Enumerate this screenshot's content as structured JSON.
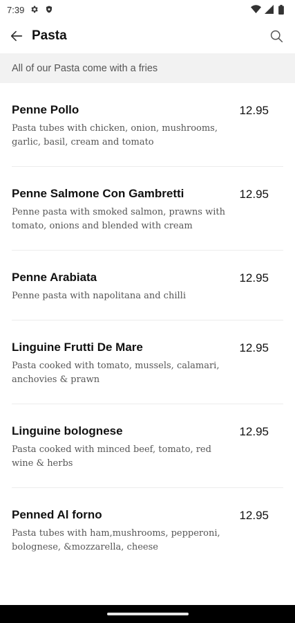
{
  "status_bar": {
    "time": "7:39",
    "left_icons": [
      "gear-icon",
      "shield-icon"
    ],
    "right_icons": [
      "wifi-icon",
      "signal-icon",
      "battery-icon"
    ]
  },
  "app_bar": {
    "title": "Pasta",
    "back_icon": "arrow-left-icon",
    "search_icon": "search-icon"
  },
  "banner": {
    "text": "All of our Pasta come with a fries"
  },
  "menu": {
    "items": [
      {
        "name": "Penne Pollo",
        "price": "12.95",
        "description": "Pasta tubes with chicken, onion, mushrooms, garlic, basil, cream and tomato"
      },
      {
        "name": "Penne Salmone Con Gambretti",
        "price": "12.95",
        "description": "Penne pasta with smoked salmon, prawns with tomato, onions and blended with cream"
      },
      {
        "name": "Penne Arabiata",
        "price": "12.95",
        "description": "Penne pasta with napolitana and chilli"
      },
      {
        "name": "Linguine Frutti De Mare",
        "price": "12.95",
        "description": "Pasta cooked with tomato, mussels, calamari, anchovies & prawn"
      },
      {
        "name": "Linguine bolognese",
        "price": "12.95",
        "description": "Pasta cooked with minced beef, tomato, red wine & herbs"
      },
      {
        "name": "Penned Al forno",
        "price": "12.95",
        "description": "Pasta tubes with ham,mushrooms, pepperoni, bolognese, &mozzarella, cheese"
      }
    ]
  },
  "colors": {
    "background": "#ffffff",
    "banner_background": "#f2f2f2",
    "divider": "#ececec",
    "navigation_bar": "#000000"
  }
}
